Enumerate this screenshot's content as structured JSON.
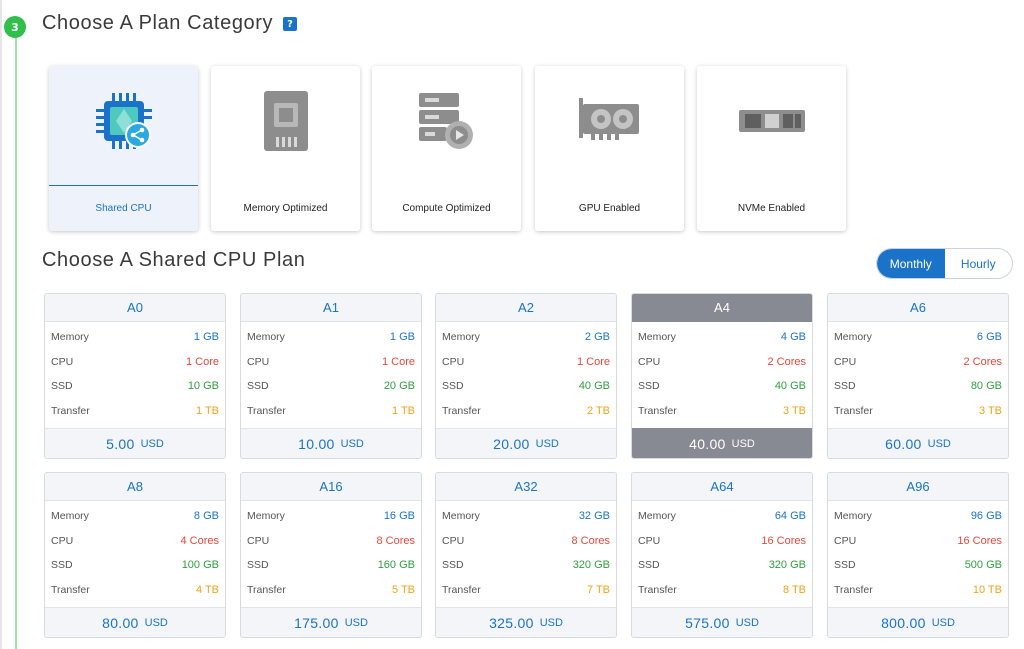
{
  "step": {
    "number": "3"
  },
  "category_section": {
    "title": "Choose A Plan Category",
    "help_icon": "question-icon"
  },
  "categories": [
    {
      "label": "Shared CPU",
      "icon": "shared-cpu-icon",
      "active": true
    },
    {
      "label": "Memory Optimized",
      "icon": "memory-module-icon",
      "active": false
    },
    {
      "label": "Compute Optimized",
      "icon": "server-gear-icon",
      "active": false
    },
    {
      "label": "GPU Enabled",
      "icon": "gpu-card-icon",
      "active": false
    },
    {
      "label": "NVMe Enabled",
      "icon": "nvme-drive-icon",
      "active": false
    }
  ],
  "plan_section": {
    "title": "Choose A Shared CPU Plan"
  },
  "billing_toggle": {
    "monthly": "Monthly",
    "hourly": "Hourly",
    "selected": "Monthly"
  },
  "labels": {
    "memory": "Memory",
    "cpu": "CPU",
    "ssd": "SSD",
    "transfer": "Transfer",
    "currency": "USD"
  },
  "colors": {
    "accent": "#1a73c9",
    "cpu": "#e5483b",
    "ssd": "#2e9e3e",
    "transfer": "#f0a21a",
    "selected": "#878a92",
    "step": "#2fbf4a"
  },
  "plans": [
    {
      "name": "A0",
      "memory": "1 GB",
      "cpu": "1 Core",
      "ssd": "10 GB",
      "transfer": "1 TB",
      "price": "5.00"
    },
    {
      "name": "A1",
      "memory": "1 GB",
      "cpu": "1 Core",
      "ssd": "20 GB",
      "transfer": "1 TB",
      "price": "10.00"
    },
    {
      "name": "A2",
      "memory": "2 GB",
      "cpu": "1 Core",
      "ssd": "40 GB",
      "transfer": "2 TB",
      "price": "20.00"
    },
    {
      "name": "A4",
      "memory": "4 GB",
      "cpu": "2 Cores",
      "ssd": "40 GB",
      "transfer": "3 TB",
      "price": "40.00",
      "selected": true
    },
    {
      "name": "A6",
      "memory": "6 GB",
      "cpu": "2 Cores",
      "ssd": "80 GB",
      "transfer": "3 TB",
      "price": "60.00"
    },
    {
      "name": "A8",
      "memory": "8 GB",
      "cpu": "4 Cores",
      "ssd": "100 GB",
      "transfer": "4 TB",
      "price": "80.00"
    },
    {
      "name": "A16",
      "memory": "16 GB",
      "cpu": "8 Cores",
      "ssd": "160 GB",
      "transfer": "5 TB",
      "price": "175.00"
    },
    {
      "name": "A32",
      "memory": "32 GB",
      "cpu": "8 Cores",
      "ssd": "320 GB",
      "transfer": "7 TB",
      "price": "325.00"
    },
    {
      "name": "A64",
      "memory": "64 GB",
      "cpu": "16 Cores",
      "ssd": "320 GB",
      "transfer": "8 TB",
      "price": "575.00"
    },
    {
      "name": "A96",
      "memory": "96 GB",
      "cpu": "16 Cores",
      "ssd": "500 GB",
      "transfer": "10 TB",
      "price": "800.00"
    }
  ]
}
